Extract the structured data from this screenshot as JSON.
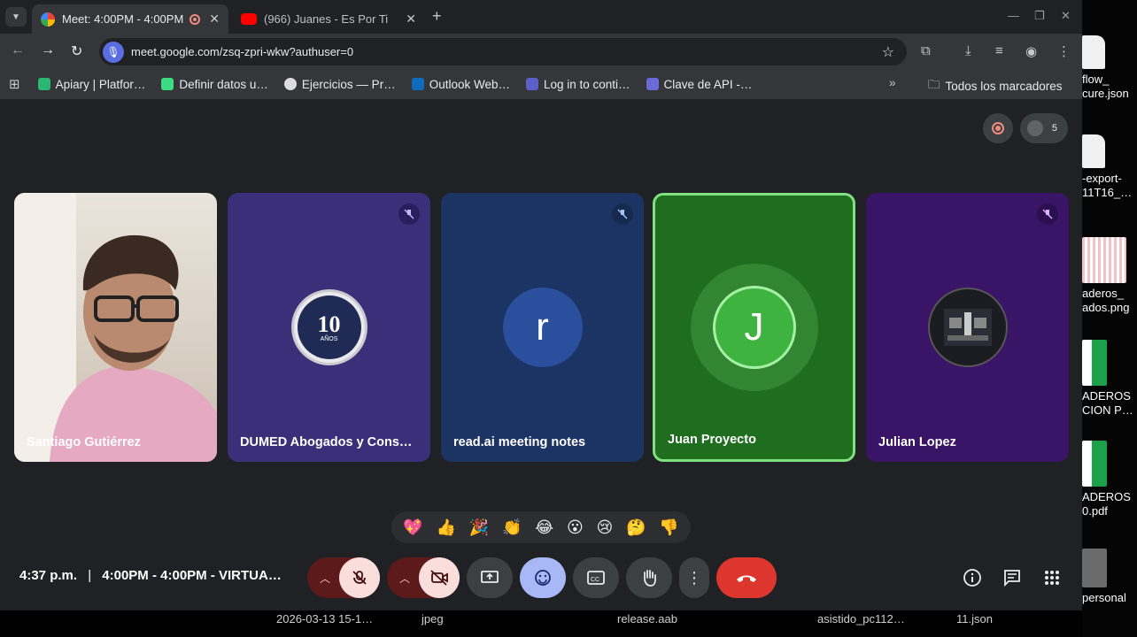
{
  "browser": {
    "tabs": [
      {
        "title": "Meet: 4:00PM - 4:00PM",
        "active": true
      },
      {
        "title": "(966) Juanes - Es Por Ti",
        "active": false
      }
    ],
    "url": "meet.google.com/zsq-zpri-wkw?authuser=0",
    "bookmarks": [
      {
        "label": "Apiary | Platfor…",
        "color": "#2bb673"
      },
      {
        "label": "Definir datos u…",
        "color": "#3ddc84"
      },
      {
        "label": "Ejercicios — Pr…",
        "color": "#dddddd"
      },
      {
        "label": "Outlook Web…",
        "color": "#0f6cbd"
      },
      {
        "label": "Log in to conti…",
        "color": "#5b5fc7"
      },
      {
        "label": "Clave de API -…",
        "color": "#6b6bd6"
      }
    ],
    "all_bookmarks": "Todos los marcadores"
  },
  "meet": {
    "participant_count": "5",
    "tiles": [
      {
        "name": "Santiago Gutiérrez",
        "kind": "video",
        "muted": false
      },
      {
        "name": "DUMED Abogados y Cons…",
        "kind": "logo",
        "logo_text": "10",
        "logo_sub": "AÑOS",
        "muted": true
      },
      {
        "name": "read.ai meeting notes",
        "kind": "initial",
        "initial": "r",
        "muted": true
      },
      {
        "name": "Juan Proyecto",
        "kind": "initial",
        "initial": "J",
        "muted": false,
        "speaking": true
      },
      {
        "name": "Julian Lopez",
        "kind": "badge",
        "muted": true
      }
    ],
    "reactions": [
      "💖",
      "👍",
      "🎉",
      "👏",
      "😂",
      "😮",
      "😢",
      "🤔",
      "👎"
    ],
    "time": "4:37 p.m.",
    "separator": "|",
    "meeting_title": "4:00PM - 4:00PM - VIRTUA…"
  },
  "taskbar": {
    "items": [
      "2026-03-13 15-1…",
      "jpeg",
      "release.aab",
      "asistido_pc112…",
      "11.json"
    ]
  },
  "desktop": {
    "files": [
      {
        "line1": "flow_",
        "line2": "cure.json"
      },
      {
        "line1": "-export-",
        "line2": "11T16_…"
      },
      {
        "line1": "aderos_",
        "line2": "ados.png"
      },
      {
        "line1": "ADEROS",
        "line2": "CION P…"
      },
      {
        "line1": "ADEROS",
        "line2": "0.pdf"
      },
      {
        "line1": "personal",
        "line2": ""
      }
    ]
  }
}
